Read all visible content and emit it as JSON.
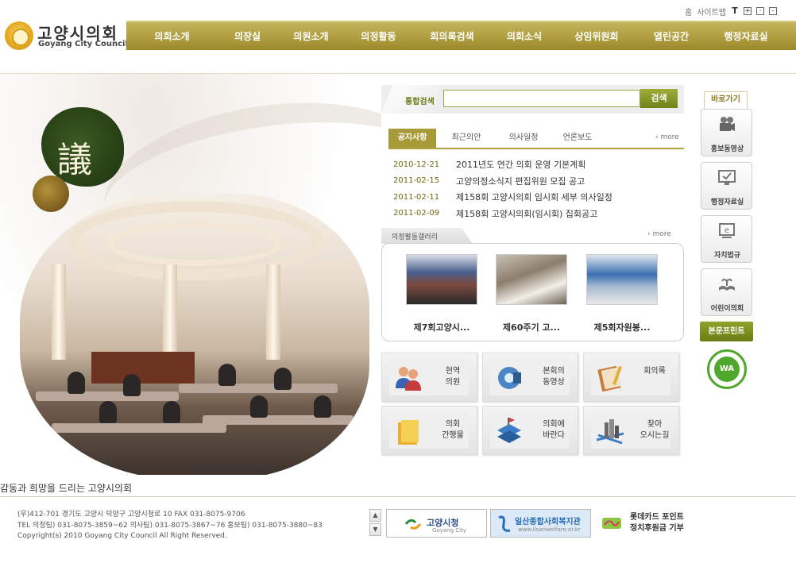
{
  "header": {
    "logo_korean": "고양시의회",
    "logo_english": "Goyang City Council",
    "util_home": "홈",
    "util_sitemap": "사이트맵",
    "font_size_label": "T",
    "font_plus": "+",
    "font_reset": "·",
    "font_minus": "-"
  },
  "gnb": {
    "items": [
      "의회소개",
      "의장실",
      "의원소개",
      "의정활동",
      "회의록검색",
      "의회소식",
      "상임위원회",
      "열린공간",
      "행정자료실"
    ]
  },
  "search": {
    "label": "통합검색",
    "value": "",
    "button": "검색"
  },
  "notice": {
    "tabs": [
      "공지사항",
      "최근의안",
      "의사일정",
      "언론보도"
    ],
    "active_tab": "공지사항",
    "more": "› more",
    "items": [
      {
        "date": "2010-12-21",
        "title": "2011년도 연간 의회 운영 기본계획"
      },
      {
        "date": "2011-02-15",
        "title": "고양의정소식지 편집위원 모집 공고"
      },
      {
        "date": "2011-02-11",
        "title": "제158회 고양시의회 임시회 세부 의사일정"
      },
      {
        "date": "2011-02-09",
        "title": "제158회 고양시의회(임시회) 집회공고"
      }
    ]
  },
  "gallery": {
    "label": "의정활동갤러리",
    "more": "› more",
    "items": [
      {
        "caption": "제7회고양시..."
      },
      {
        "caption": "제60주기 고..."
      },
      {
        "caption": "제5회자원봉..."
      }
    ]
  },
  "quick_links": [
    {
      "label": "현역\n의원",
      "icon": "people-icon"
    },
    {
      "label": "본회의\n동영상",
      "icon": "video-icon"
    },
    {
      "label": "회의록",
      "icon": "book-icon"
    },
    {
      "label": "의회\n간행물",
      "icon": "folder-icon"
    },
    {
      "label": "의회에\n바란다",
      "icon": "blocks-icon"
    },
    {
      "label": "찾아\n오시는길",
      "icon": "map-icon"
    }
  ],
  "right_menu": {
    "title": "바로가기",
    "items": [
      {
        "label": "홍보동영상",
        "icon": "camera-icon"
      },
      {
        "label": "행정자료실",
        "icon": "monitor-icon"
      },
      {
        "label": "자치법규",
        "icon": "law-icon"
      },
      {
        "label": "어린이의회",
        "icon": "book-open-icon"
      }
    ],
    "print": "본문프린트",
    "wa_badge": "WA"
  },
  "hero": {
    "ink_character": "議",
    "slogan": "감동과 희망을 드리는 고양시의회"
  },
  "footer": {
    "address_line1": "(우)412-701 경기도 고양시 덕양구 고양시청로 10 FAX 031-8075-9706",
    "address_line2": "TEL 의정팀) 031-8075-3859~62 의사팀) 031-8075-3867~76 홍보팀) 031-8075-3880~83",
    "copyright": "Copyright(s) 2010 Goyang City Council All Right Reserved.",
    "scroll_up": "▲",
    "scroll_down": "▼",
    "banners": [
      {
        "title": "고양시청",
        "sub": "Goyang City"
      },
      {
        "title": "일산종합사회복지관",
        "sub": "www.ilsanwelfare.or.kr"
      },
      {
        "title": "롯데카드 포인트\n정치후원금 기부",
        "sub": ""
      }
    ]
  },
  "colors": {
    "accent": "#a89a38",
    "nav_gradient_top": "#c3b45d",
    "nav_gradient_bottom": "#9c8a2b",
    "date_text": "#6b6b10",
    "green_button": "#6b7d13"
  }
}
